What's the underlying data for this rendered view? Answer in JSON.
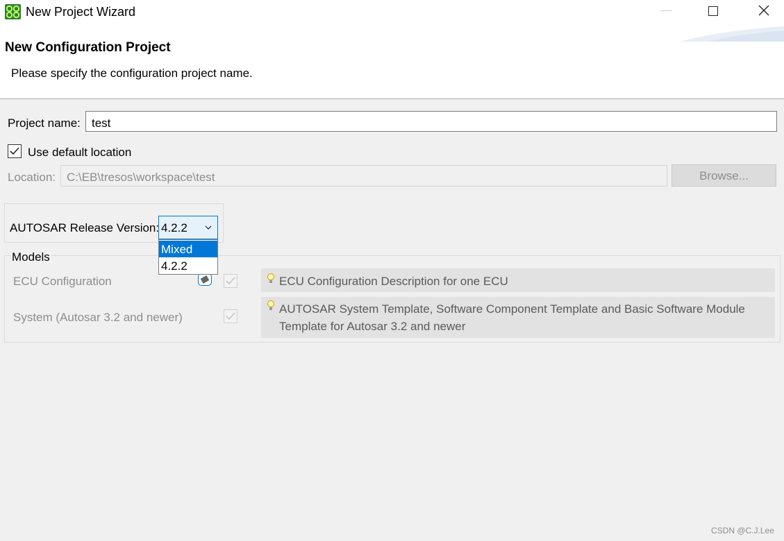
{
  "window": {
    "title": "New Project Wizard"
  },
  "header": {
    "title": "New Configuration Project",
    "description": "Please specify the configuration project name."
  },
  "form": {
    "project_name_label": "Project name:",
    "project_name_value": "test",
    "use_default_location_label": "Use default location",
    "use_default_location_checked": true,
    "location_label": "Location:",
    "location_value": "C:\\EB\\tresos\\workspace\\test",
    "browse_label": "Browse...",
    "autosar_release_label": "AUTOSAR Release Version:",
    "autosar_release_value": "4.2.2"
  },
  "dropdown": {
    "options": [
      "Mixed",
      "4.2.2"
    ],
    "highlighted": "Mixed"
  },
  "models": {
    "group_label": "Models",
    "items": [
      {
        "name": "ECU Configuration",
        "checked": true,
        "description": "ECU Configuration Description for one ECU"
      },
      {
        "name": "System (Autosar 3.2 and newer)",
        "checked": true,
        "description_line1": "AUTOSAR System Template, Software Component Template and Basic Software Module",
        "description_line2": "Template for Autosar 3.2 and newer"
      }
    ]
  },
  "watermark": "CSDN @C.J.Lee",
  "colors": {
    "accent": "#0078d7",
    "app_icon": "#2e7d32",
    "disabled_text": "#8d8d8d"
  }
}
